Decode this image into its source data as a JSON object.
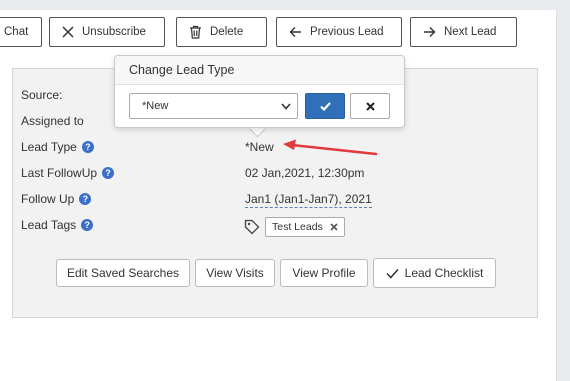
{
  "toolbar": {
    "chat_label": "Chat",
    "unsubscribe_label": "Unsubscribe",
    "delete_label": "Delete",
    "previous_label": "Previous Lead",
    "next_label": "Next Lead"
  },
  "popover": {
    "title": "Change Lead Type",
    "selected_option": "*New"
  },
  "fields": {
    "source_label": "Source:",
    "assigned_label": "Assigned to",
    "lead_type_label": "Lead Type",
    "lead_type_value": "*New",
    "last_followup_label": "Last FollowUp",
    "last_followup_value": "02 Jan,2021, 12:30pm",
    "follow_up_label": "Follow Up",
    "follow_up_value": "Jan1 (Jan1-Jan7), 2021",
    "lead_tags_label": "Lead Tags",
    "tag_value": "Test Leads"
  },
  "actions": {
    "edit_saved_searches": "Edit Saved Searches",
    "view_visits": "View Visits",
    "view_profile": "View Profile",
    "lead_checklist": "Lead Checklist"
  },
  "colors": {
    "accent": "#2f70b8",
    "help_icon": "#3b6fc9",
    "annotation_arrow": "#e0393e"
  },
  "icons": [
    "close-icon",
    "trash-icon",
    "arrow-left-icon",
    "arrow-right-icon",
    "check-icon",
    "help-icon",
    "tag-icon",
    "chevron-down-icon"
  ]
}
